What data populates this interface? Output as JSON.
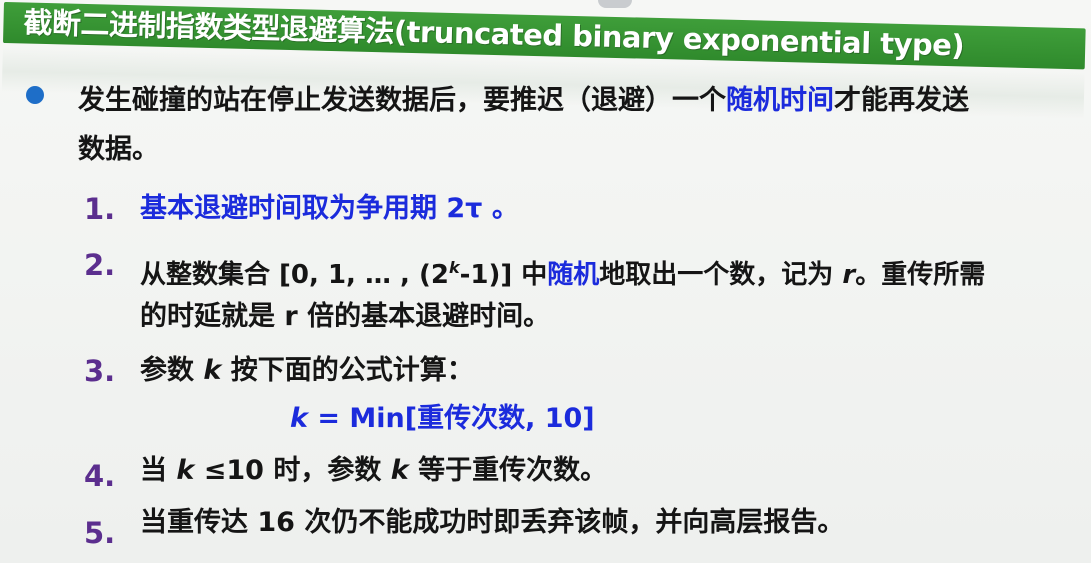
{
  "title": "截断二进制指数类型退避算法(truncated binary exponential type)",
  "intro": {
    "line1_a": "发生碰撞的站在停止发送数据后，要推迟（退避）一个",
    "line1_highlight": "随机时间",
    "line1_b": "才能再发送",
    "line2": "数据。"
  },
  "items": [
    {
      "number": "1.",
      "text": "基本退避时间取为争用期 2τ 。"
    },
    {
      "number": "2.",
      "line1_a": "从整数集合 [0, 1, … , (2",
      "line1_sup": "k",
      "line1_b": "-1)] 中",
      "line1_highlight": "随机",
      "line1_c": "地取出一个数，记为 ",
      "line1_r": "r",
      "line1_d": "。重传所需",
      "line2": "的时延就是 r 倍的基本退避时间。"
    },
    {
      "number": "3.",
      "text_a": "参数 ",
      "text_k": "k",
      "text_b": " 按下面的公式计算：",
      "formula_k": "k",
      "formula_rest": " = Min[重传次数, 10]"
    },
    {
      "number": "4.",
      "text_a": "当 ",
      "text_k1": "k",
      "text_b": " ≤10 时，参数 ",
      "text_k2": "k",
      "text_c": " 等于重传次数。"
    },
    {
      "number": "5.",
      "text": "当重传达 16 次仍不能成功时即丢弃该帧，并向高层报告。"
    }
  ],
  "colors": {
    "title_bg": "#2f8a2c",
    "bullet": "#1e6ec8",
    "highlight": "#1b2bdc",
    "numbers": "#5b2e8e",
    "text": "#151515"
  }
}
